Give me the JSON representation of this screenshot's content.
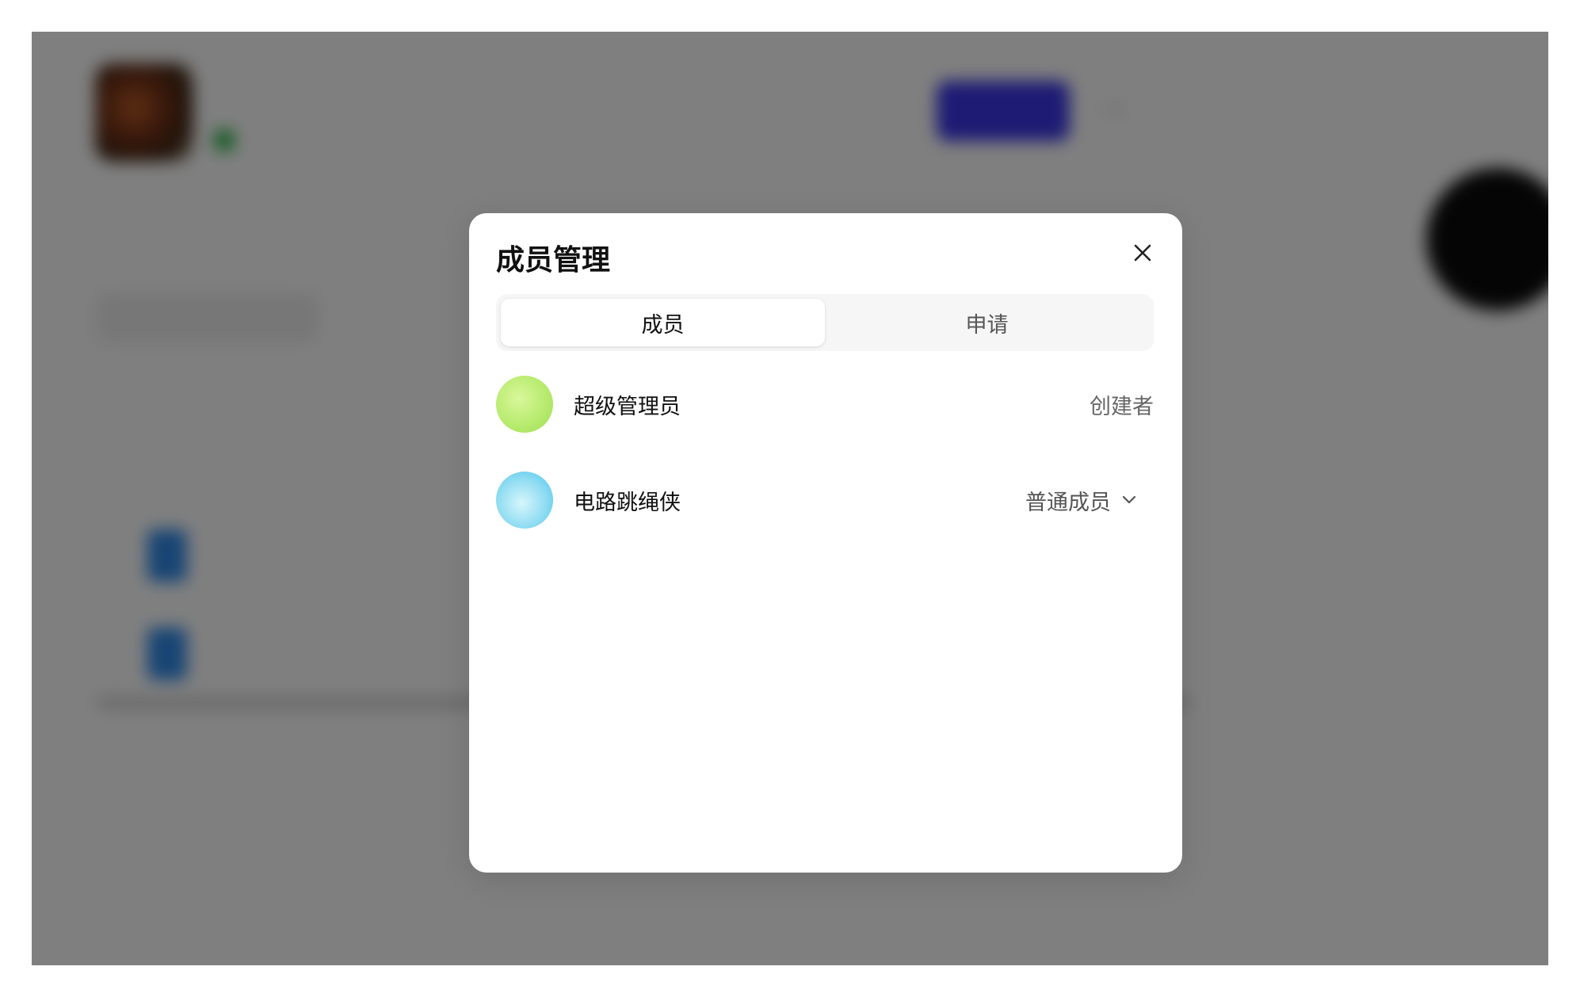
{
  "modal": {
    "title": "成员管理",
    "tabs": [
      {
        "label": "成员",
        "active": true
      },
      {
        "label": "申请",
        "active": false
      }
    ],
    "members": [
      {
        "name": "超级管理员",
        "role": "创建者",
        "role_editable": false,
        "avatar_colors": [
          "#c7f07a",
          "#a8e063"
        ]
      },
      {
        "name": "电路跳绳侠",
        "role": "普通成员",
        "role_editable": true,
        "avatar_colors": [
          "#9fe8f7",
          "#4fc8eb"
        ]
      }
    ],
    "icons": {
      "close": "close-icon",
      "role_dropdown": "chevron-down-icon"
    }
  },
  "colors": {
    "overlay": "rgba(0,0,0,0.5)",
    "accent": "#3b36e8",
    "text_primary": "#111111",
    "text_secondary": "#666666"
  }
}
